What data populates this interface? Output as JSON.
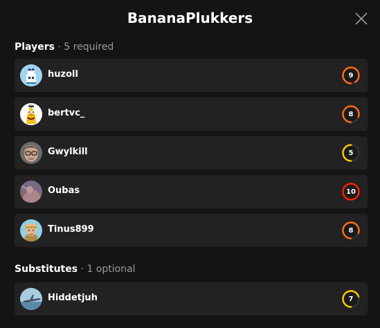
{
  "modal": {
    "title": "BananaPlukkers"
  },
  "players": {
    "label": "Players",
    "sub": "5 required",
    "items": [
      {
        "name": "huzoll",
        "level": "9",
        "level_color": "#ff6a13"
      },
      {
        "name": "bertvc_",
        "level": "8",
        "level_color": "#ff6a13"
      },
      {
        "name": "Gwylkill",
        "level": "5",
        "level_color": "#ffc800"
      },
      {
        "name": "Oubas",
        "level": "10",
        "level_color": "#fe1f00"
      },
      {
        "name": "Tinus899",
        "level": "8",
        "level_color": "#ff6a13"
      }
    ]
  },
  "substitutes": {
    "label": "Substitutes",
    "sub": "1 optional",
    "items": [
      {
        "name": "Hiddetjuh",
        "level": "7",
        "level_color": "#ffc800"
      }
    ]
  },
  "icons": {
    "close": "close-icon",
    "level": "skill-level-icon"
  }
}
